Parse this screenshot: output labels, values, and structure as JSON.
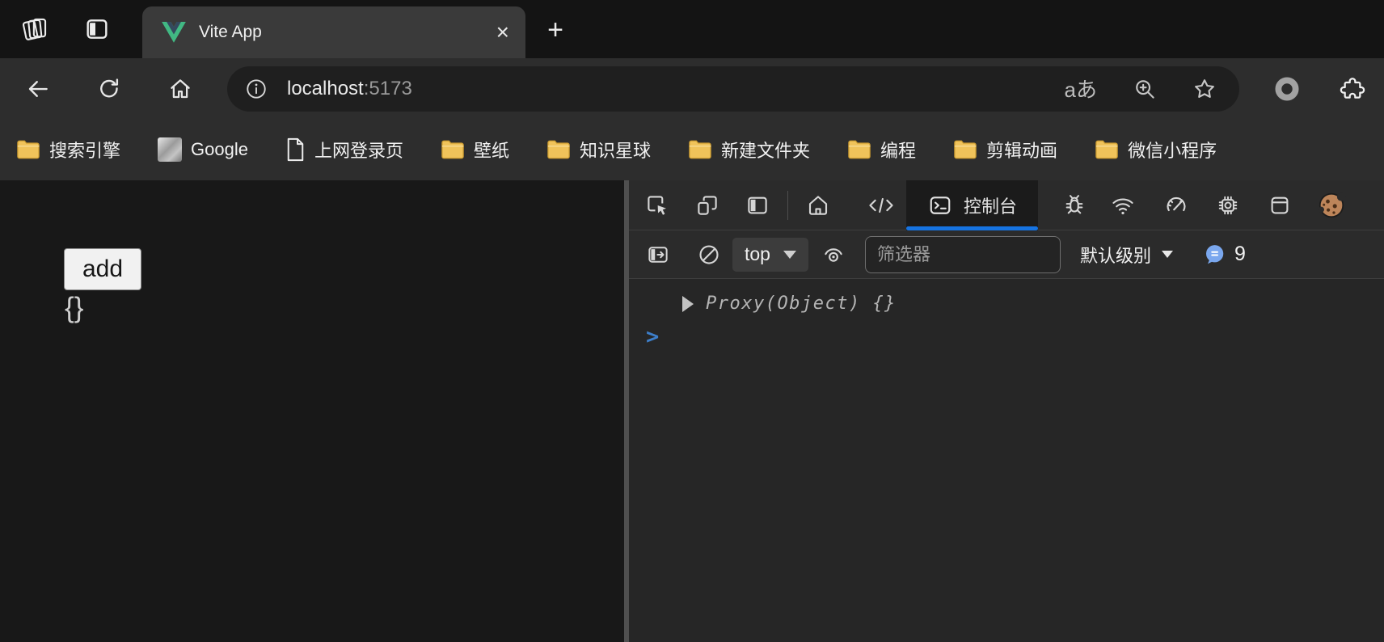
{
  "tabbar": {
    "tab_title": "Vite App",
    "close_label": "×",
    "new_tab_label": "+"
  },
  "navbar": {
    "url_host": "localhost",
    "url_port": ":5173",
    "translate_label": "aあ"
  },
  "bookmarks": [
    {
      "label": "搜索引擎",
      "icon": "folder-icon"
    },
    {
      "label": "Google",
      "icon": "favicon-image"
    },
    {
      "label": "上网登录页",
      "icon": "page-icon"
    },
    {
      "label": "壁纸",
      "icon": "folder-icon"
    },
    {
      "label": "知识星球",
      "icon": "folder-icon"
    },
    {
      "label": "新建文件夹",
      "icon": "folder-icon"
    },
    {
      "label": "编程",
      "icon": "folder-icon"
    },
    {
      "label": "剪辑动画",
      "icon": "folder-icon"
    },
    {
      "label": "微信小程序",
      "icon": "folder-icon"
    }
  ],
  "page": {
    "add_button_label": "add",
    "object_text": "{}"
  },
  "devtools": {
    "console_tab_label": "控制台",
    "frame_selector_value": "top",
    "filter_placeholder": "筛选器",
    "log_level_label": "默认级别",
    "message_count": "9",
    "log_entry": "Proxy(Object) {}",
    "prompt_symbol": ">"
  },
  "colors": {
    "accent_blue": "#1673e1",
    "vue_green": "#41b883",
    "vue_dark": "#34495e",
    "folder_yellow": "#f0c35a",
    "badge_blue": "#7aa7ee",
    "prompt_blue": "#3d7ec9"
  }
}
